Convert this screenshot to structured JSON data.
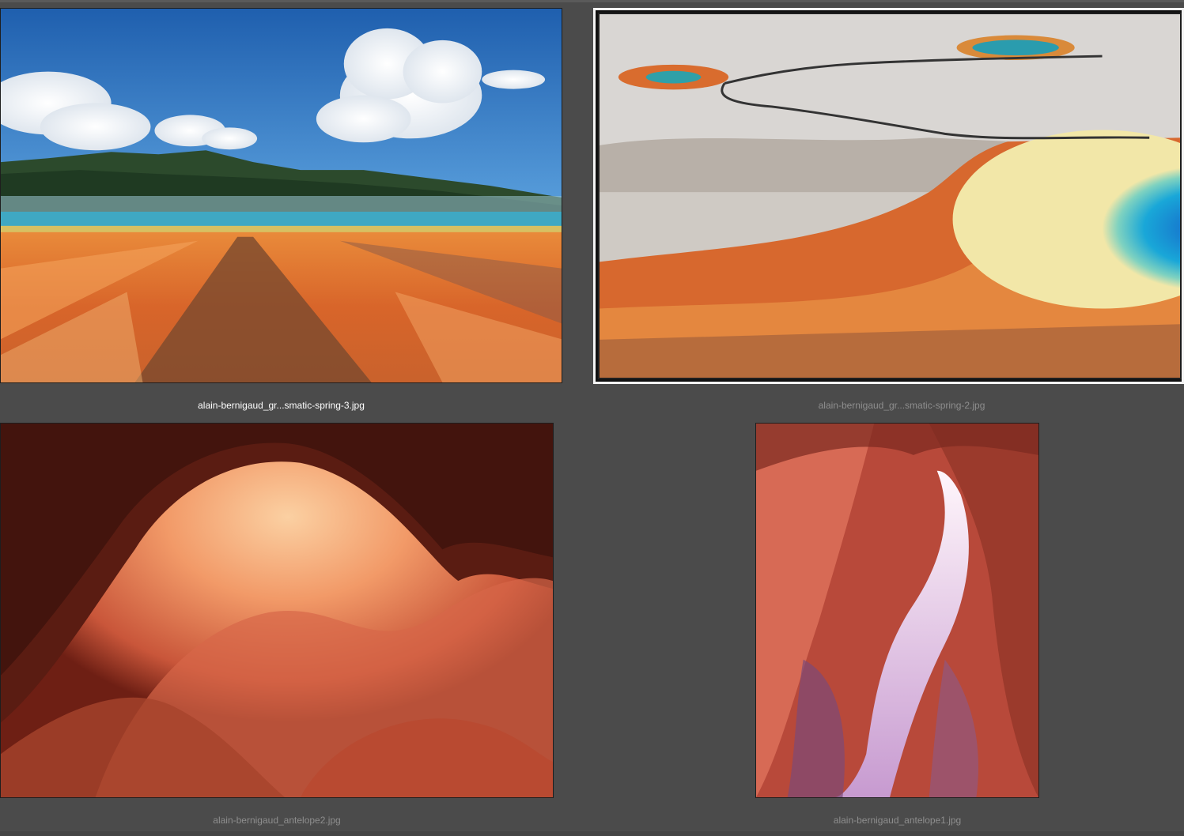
{
  "gallery": {
    "items": [
      {
        "filename": "alain-bernigaud_gr...smatic-spring-3.jpg",
        "selected": true
      },
      {
        "filename": "alain-bernigaud_gr...smatic-spring-2.jpg",
        "selected": false
      },
      {
        "filename": "alain-bernigaud_antelope2.jpg",
        "selected": false
      },
      {
        "filename": "alain-bernigaud_antelope1.jpg",
        "selected": false
      }
    ]
  },
  "colors": {
    "background": "#4b4b4b",
    "selected_caption": "#ffffff",
    "unselected_caption": "#8e8e8e",
    "selected_frame": "#f4f4f4"
  }
}
